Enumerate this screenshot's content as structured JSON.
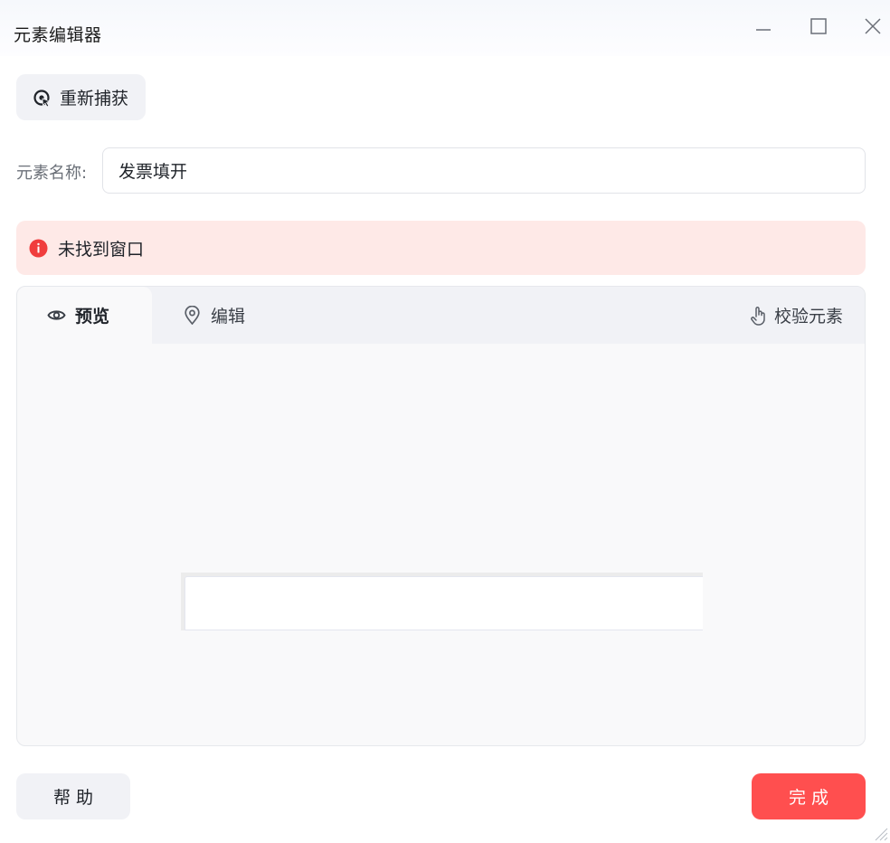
{
  "window": {
    "title": "元素编辑器",
    "controls": [
      "minimize-icon",
      "maximize-icon",
      "close-icon"
    ]
  },
  "toolbar": {
    "recapture_label": "重新捕获",
    "recapture_icon": "recapture-icon"
  },
  "element_name": {
    "label": "元素名称:",
    "value": "发票填开"
  },
  "alert": {
    "icon": "error-icon",
    "message": "未找到窗口",
    "color": "#f03d3d",
    "background": "#fee9e7"
  },
  "tabs": [
    {
      "label": "预览",
      "icon": "eye-icon",
      "active": true
    },
    {
      "label": "编辑",
      "icon": "location-pin-icon",
      "active": false
    }
  ],
  "verify": {
    "label": "校验元素",
    "icon": "pointing-hand-icon"
  },
  "footer": {
    "help_label": "帮 助",
    "done_label": "完 成"
  },
  "colors": {
    "accent": "#ff4f4f",
    "neutral_button": "#f1f2f6"
  }
}
